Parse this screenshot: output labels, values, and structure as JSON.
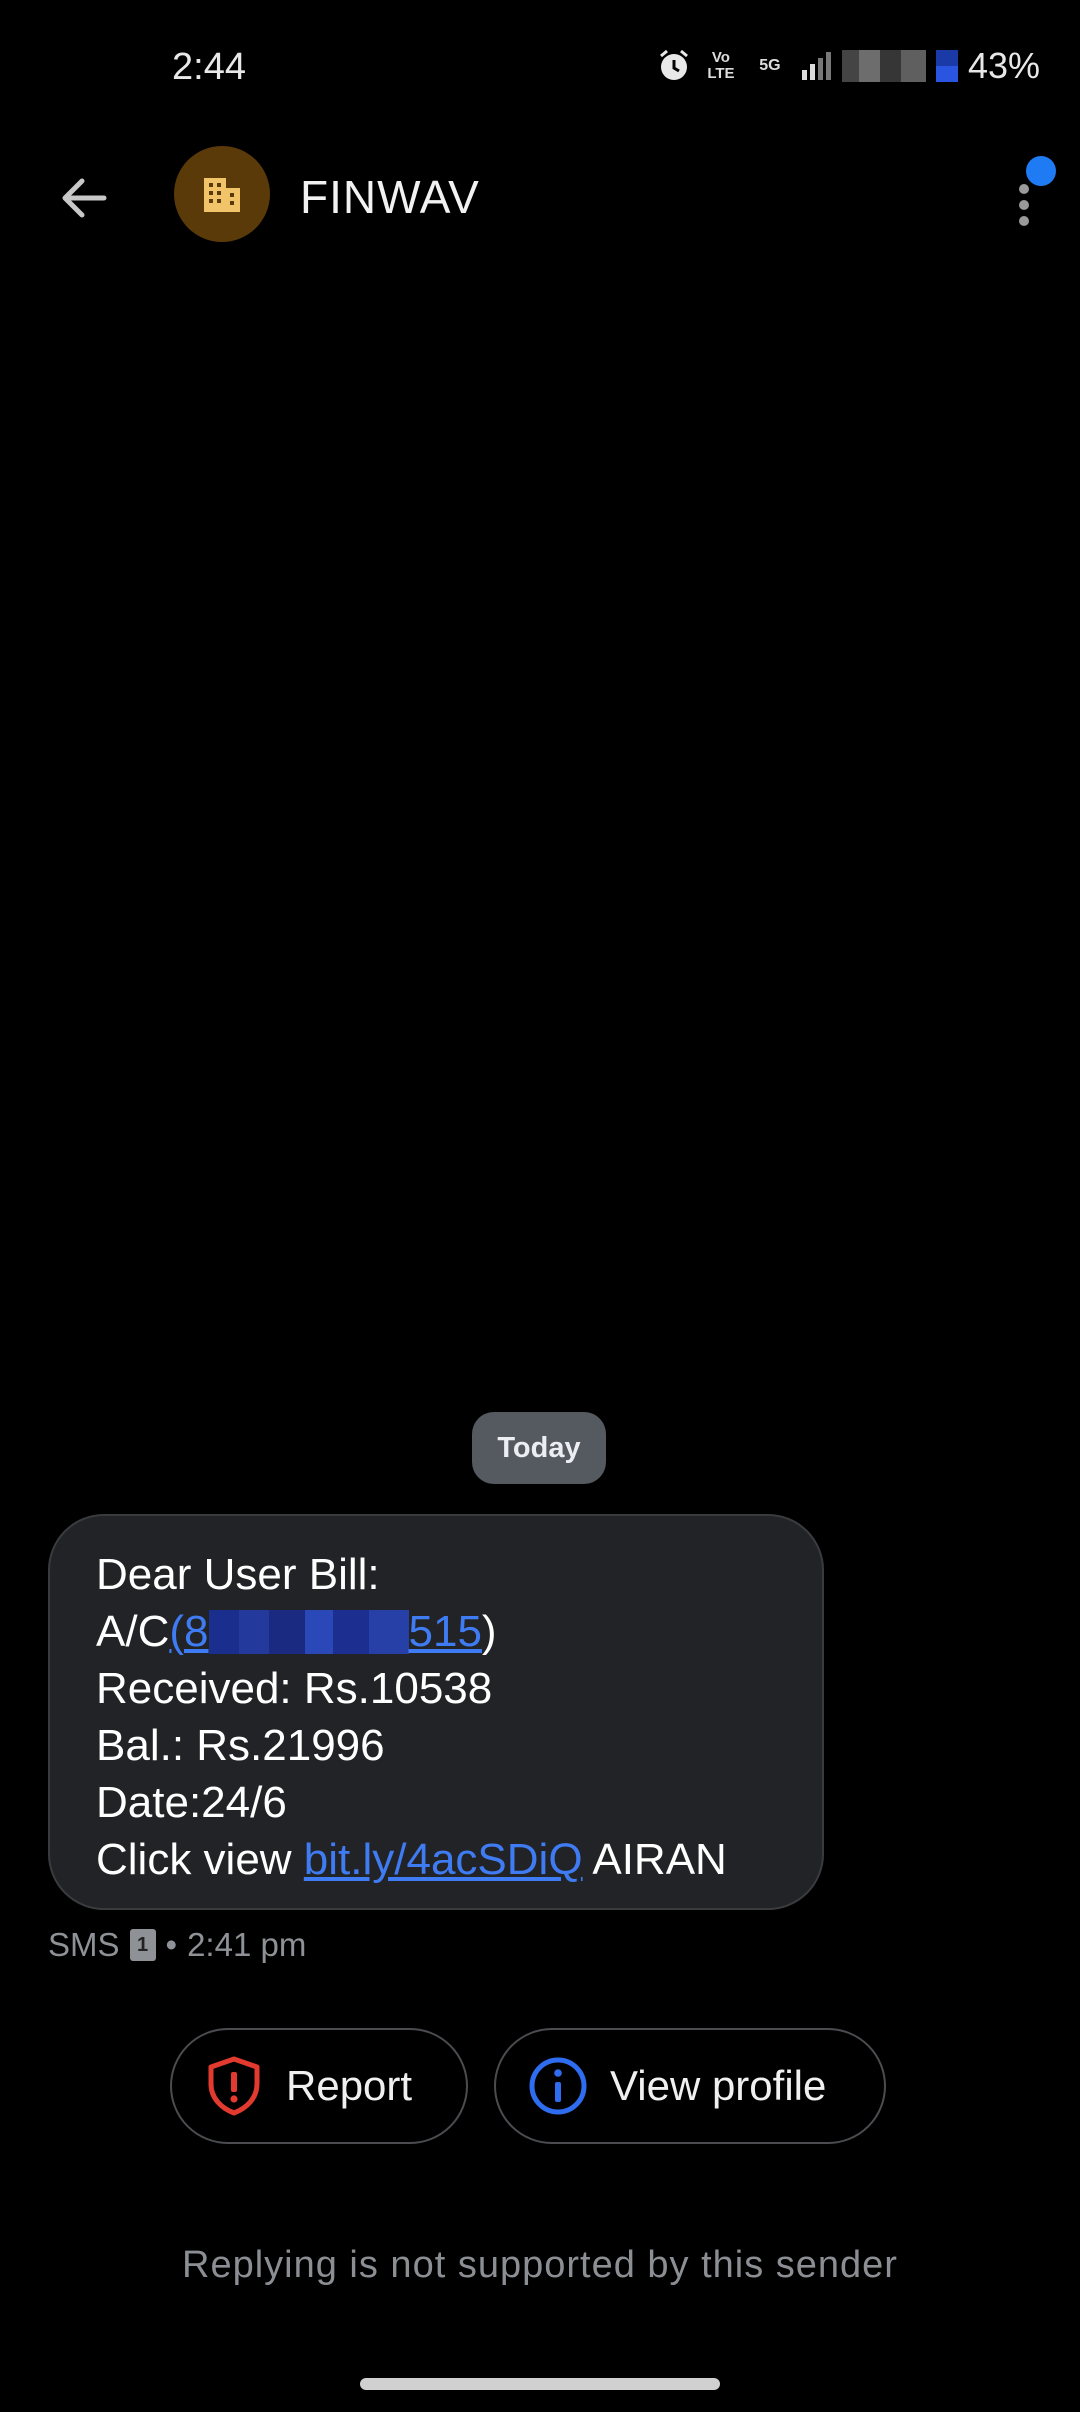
{
  "status_bar": {
    "time": "2:44",
    "volte": "Vo LTE",
    "network": "5G",
    "battery": "43%"
  },
  "header": {
    "contact_name": "FINWAV",
    "avatar_icon": "building-icon",
    "avatar_color": "#5b3a0a",
    "badge_color": "#1f7bf4"
  },
  "conversation": {
    "date_chip": "Today",
    "message": {
      "line1": "Dear User Bill:",
      "line2_prefix": "A/C",
      "line2_open": "(",
      "account_link_start": "8",
      "account_link_end": "515",
      "line2_close": ")",
      "line3": "Received: Rs.10538",
      "line4": "Bal.: Rs.21996",
      "line5": "Date:24/6",
      "line6_prefix": "Click view ",
      "url": "bit.ly/4acSDiQ",
      "line6_suffix": " AIRAN"
    },
    "meta": {
      "channel": "SMS",
      "sim": "1",
      "separator": "•",
      "time": "2:41 pm"
    }
  },
  "actions": {
    "report_label": "Report",
    "view_profile_label": "View profile",
    "report_color": "#e23a2e",
    "view_profile_color": "#2f6df0"
  },
  "footer": {
    "reply_note": "Replying is not supported by this sender"
  }
}
